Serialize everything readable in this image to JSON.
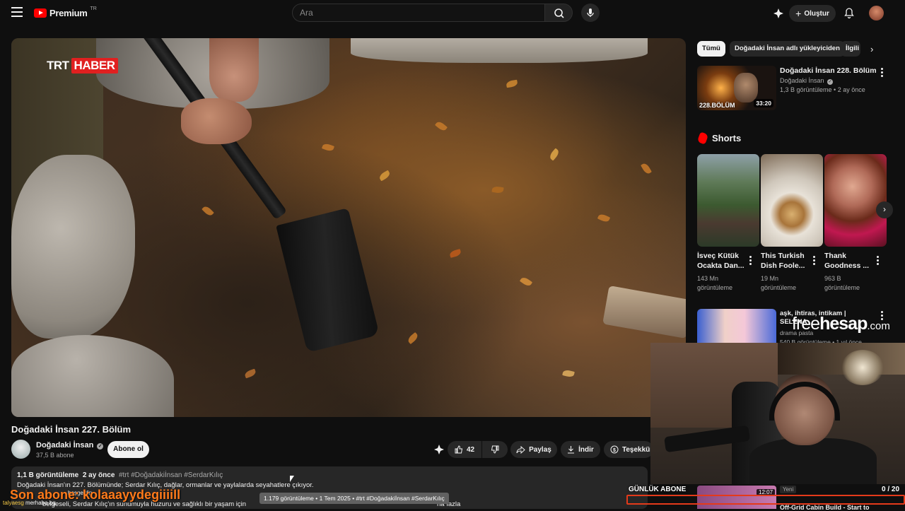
{
  "header": {
    "logo_text": "Premium",
    "logo_region": "TR",
    "search_placeholder": "Ara",
    "create_label": "Oluştur"
  },
  "video": {
    "channel_logo_a": "TRT",
    "channel_logo_b": "HABER",
    "title": "Doğadaki İnsan 227. Bölüm",
    "channel": "Doğadaki İnsan",
    "subscribers": "37,5 B abone",
    "subscribe_label": "Abone ol",
    "likes": "42",
    "share_label": "Paylaş",
    "download_label": "İndir",
    "thanks_label": "Teşekkür",
    "description": {
      "views": "1,1 B görüntüleme",
      "age": "2 ay önce",
      "tags": "#trt #Doğadakiİnsan #SerdarKılıç",
      "line1": "Doğadaki İnsan'ın 227. Bölümünde; Serdar Kılıç, dağlar, ormanlar ve yaylalarda seyahatlere çıkıyor.",
      "line2": "belgeseli, Serdar Kılıç'ın sunumuyla huzuru ve sağlıklı bir yaşam için",
      "line2_end": "ha fazla"
    },
    "tooltip": "1.179 görüntüleme • 1 Tem 2025 • #trt #Doğadakiİnsan #SerdarKılıç"
  },
  "chips": [
    "Tümü",
    "Doğadaki İnsan adlı yükleyiciden",
    "İlgili"
  ],
  "recommended": {
    "title": "Doğadaki İnsan 228. Bölüm",
    "channel": "Doğadaki İnsan",
    "meta": "1,3 B görüntüleme • 2 ay önce",
    "duration": "33:20",
    "thumb_text": "228.BÖLÜM"
  },
  "shorts": {
    "heading": "Shorts",
    "items": [
      {
        "title": "İsveç Kütük Ocakta Dan...",
        "views": "143 Mn görüntüleme"
      },
      {
        "title": "This Turkish Dish Foole...",
        "views": "19 Mn görüntüleme"
      },
      {
        "title": "Thank Goodness ...",
        "views": "963 B görüntüleme"
      }
    ]
  },
  "recommended2": {
    "title": "aşk, ihtiras, intikam | SELENA",
    "channel": "drama pasta",
    "meta": "540 B görüntüleme • 1 yıl önce"
  },
  "watermark": {
    "a": "free",
    "b": "hesap",
    "c": ".com"
  },
  "stream": {
    "daily_label": "GÜNLÜK ABONE",
    "daily_count": "0 / 20",
    "last_sub": "Son abone: kolaaayydegiiiill",
    "chat_user": "talyaesg",
    "chat_msg1": "merhaba.bg",
    "chat_msg2": "hoşgeldin",
    "mini_duration": "12:07",
    "mini_badge": "Yeni",
    "mini_title": "Off-Grid Cabin Build - Start to"
  }
}
